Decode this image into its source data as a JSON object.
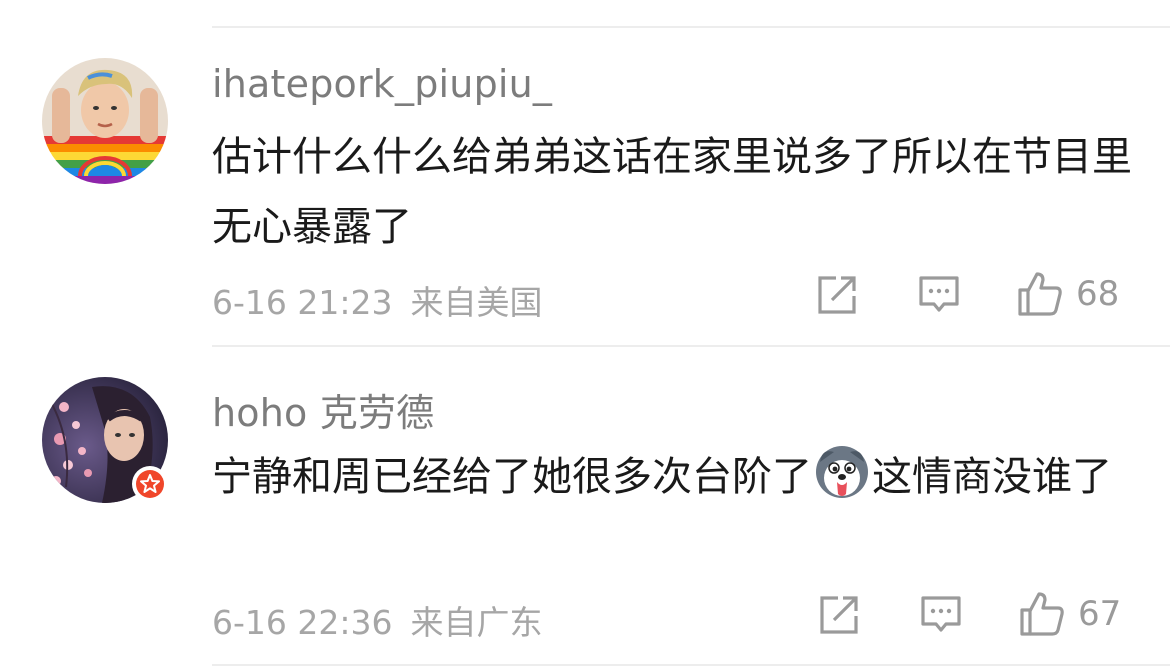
{
  "comments": [
    {
      "username": "ihatepork_piupiu_",
      "text": "估计什么什么给弟弟这话在家里说多了所以在节目里无心暴露了",
      "date": "6-16 21:23",
      "location": "来自美国",
      "likes": "68"
    },
    {
      "username": "hoho 克劳德",
      "text_before_emoji": "宁静和周已经给了她很多次台阶了",
      "emoji": "dog-tongue-emoji",
      "text_after_emoji": "这情商没谁了",
      "date": "6-16 22:36",
      "location": "来自广东",
      "likes": "67"
    }
  ],
  "icons": {
    "share": "share-icon",
    "comment": "comment-icon",
    "like": "thumbs-up-icon",
    "vip": "vip-star-badge"
  },
  "colors": {
    "username": "#7c7c7c",
    "body": "#1a1a1a",
    "meta": "#a6a6a6",
    "badge": "#f0462a",
    "divider": "#ededed"
  }
}
